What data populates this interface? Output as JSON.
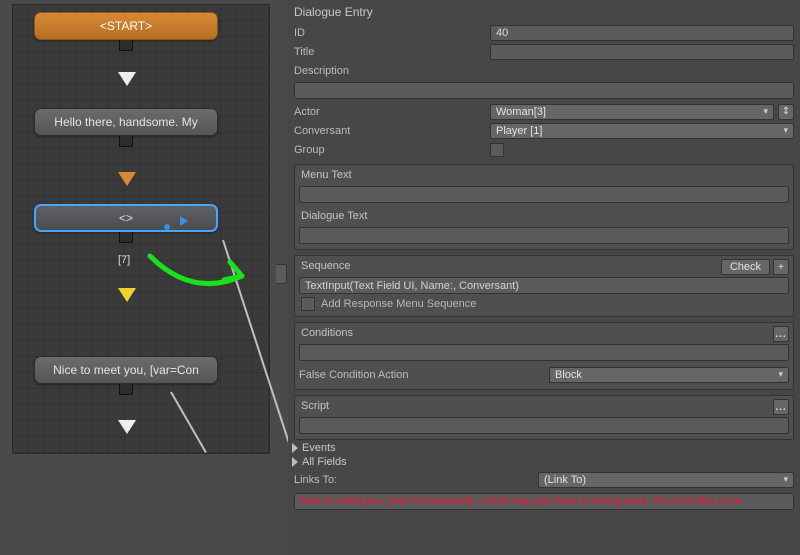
{
  "graph": {
    "start": "<START>",
    "node1": "Hello there, handsome. My",
    "node2": "<>",
    "node2_priority": "[7]",
    "node3": "Nice to meet you, [var=Con"
  },
  "inspector": {
    "header": "Dialogue Entry",
    "id_label": "ID",
    "id_value": "40",
    "title_label": "Title",
    "title_value": "",
    "desc_label": "Description",
    "actor_label": "Actor",
    "actor_value": "Woman[3]",
    "conv_label": "Conversant",
    "conv_value": "Player [1]",
    "group_label": "Group",
    "menutext_label": "Menu Text",
    "dialoguetext_label": "Dialogue Text",
    "sequence_label": "Sequence",
    "check_btn": "Check",
    "plus_btn": "+",
    "sequence_value": "TextInput(Text Field UI, Name:, Conversant)",
    "addresp_label": "Add Response Menu Sequence",
    "conditions_label": "Conditions",
    "falsecond_label": "False Condition Action",
    "falsecond_value": "Block",
    "script_label": "Script",
    "events_label": "Events",
    "allfields_label": "All Fields",
    "linksto_label": "Links To:",
    "linksto_value": "(Link To)",
    "red_text": "Nice to meet you, [var=Conversant]. I must say, you have a strong aura. You look like a ma"
  }
}
